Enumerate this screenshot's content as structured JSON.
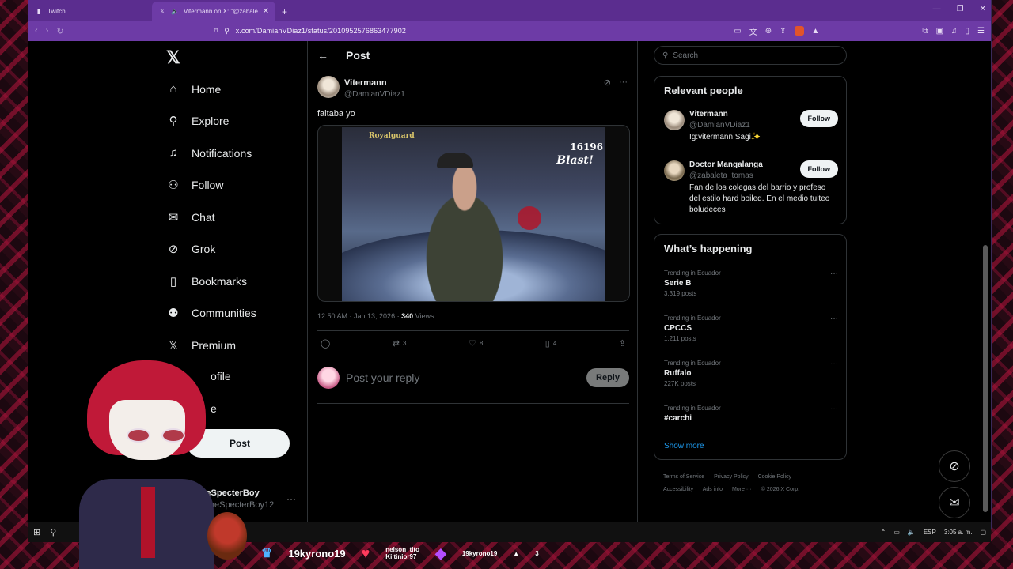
{
  "browser": {
    "tabs": [
      {
        "label": "Twitch",
        "active": false
      },
      {
        "label": "Vitermann on X: \"@zabaleta_",
        "active": true
      }
    ],
    "url": "x.com/DamianVDiaz1/status/2010952576863477902"
  },
  "nav": {
    "items": [
      {
        "label": "Home",
        "icon": "home-icon"
      },
      {
        "label": "Explore",
        "icon": "search-icon"
      },
      {
        "label": "Notifications",
        "icon": "bell-icon"
      },
      {
        "label": "Follow",
        "icon": "person-add-icon"
      },
      {
        "label": "Chat",
        "icon": "mail-icon"
      },
      {
        "label": "Grok",
        "icon": "grok-icon"
      },
      {
        "label": "Bookmarks",
        "icon": "bookmark-icon"
      },
      {
        "label": "Communities",
        "icon": "people-icon"
      },
      {
        "label": "Premium",
        "icon": "x-icon"
      },
      {
        "label": "ofile",
        "icon": "profile-icon"
      },
      {
        "label": "e",
        "icon": "more-icon"
      }
    ],
    "post_label": "Post",
    "account": {
      "name": "TheSpecterBoy",
      "handle": "@TheSpecterBoy12"
    }
  },
  "post": {
    "header": "Post",
    "author_name": "Vitermann",
    "author_handle": "@DamianVDiaz1",
    "text": "faltaba yo",
    "video_hud": "Royalguard",
    "video_score": "16196",
    "video_blast": "Blast!",
    "time": "12:50 AM · Jan 13, 2026 · ",
    "views": "340",
    "views_label": " Views",
    "reposts": "3",
    "likes": "8",
    "bookmarks": "4",
    "reply_placeholder": "Post your reply",
    "reply_button": "Reply"
  },
  "sidebar": {
    "search_placeholder": "Search",
    "relevant_title": "Relevant people",
    "people": [
      {
        "name": "Vitermann",
        "handle": "@DamianVDiaz1",
        "bio": "Ig:vitermann Sagi✨",
        "follow": "Follow"
      },
      {
        "name": "Doctor Mangalanga",
        "handle": "@zabaleta_tomas",
        "bio": "Fan de los colegas del barrio y profeso del estilo hard boiled. En el medio tuiteo boludeces",
        "follow": "Follow"
      }
    ],
    "happening_title": "What’s happening",
    "trends": [
      {
        "context": "Trending in Ecuador",
        "title": "Serie B",
        "count": "3,319 posts"
      },
      {
        "context": "Trending in Ecuador",
        "title": "CPCCS",
        "count": "1,211 posts"
      },
      {
        "context": "Trending in Ecuador",
        "title": "Ruffalo",
        "count": "227K posts"
      },
      {
        "context": "Trending in Ecuador",
        "title": "#carchi",
        "count": ""
      }
    ],
    "show_more": "Show more",
    "footer": [
      "Terms of Service",
      "Privacy Policy",
      "Cookie Policy",
      "Accessibility",
      "Ads info",
      "More ···",
      "© 2026 X Corp."
    ]
  },
  "taskbar": {
    "lang": "ESP",
    "time": "3:05 a. m."
  },
  "overlay": {
    "top_user": "19kyrono19",
    "follower_name": "nelson_tito",
    "follower_sub": "Ki tinior97",
    "sub_user": "19kyrono19",
    "sub_count": "3"
  }
}
